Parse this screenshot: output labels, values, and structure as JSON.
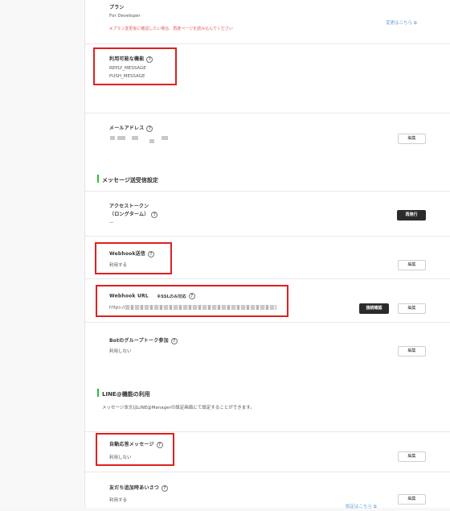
{
  "plan": {
    "label": "プラン",
    "value": "For Developer",
    "warning": "※プラン変更後に確認したい場合、再度ページを読み込んでください",
    "change_link": "変更はこちら"
  },
  "features": {
    "label": "利用可能な機能",
    "items": [
      "REPLY_MESSAGE",
      "PUSH_MESSAGE"
    ]
  },
  "email": {
    "label": "メールアドレス",
    "edit": "編集"
  },
  "messaging_section": {
    "title": "メッセージ送受信設定"
  },
  "access_token": {
    "label_line1": "アクセストークン",
    "label_line2": "（ロングターム）",
    "value": "—",
    "reissue": "再発行"
  },
  "webhook_send": {
    "label": "Webhook送信",
    "value": "利用する",
    "edit": "編集"
  },
  "webhook_url": {
    "label": "Webhook URL",
    "note": "※SSLのみ対応",
    "prefix": "https://",
    "verify": "接続確認",
    "edit": "編集"
  },
  "group_join": {
    "label": "Botのグループトーク参加",
    "value": "利用しない",
    "edit": "編集"
  },
  "line_section": {
    "title": "LINE@機能の利用",
    "desc": "メッセージ本文はLINE@Managerの設定画面にて設定することができます。"
  },
  "auto_reply": {
    "label": "自動応答メッセージ",
    "value": "利用しない",
    "edit": "編集"
  },
  "friend_greeting": {
    "label": "友だち追加時あいさつ",
    "value": "利用する",
    "settings_link": "設定はこちら",
    "edit": "編集"
  },
  "icons": {
    "help": "?",
    "external": "⧉"
  }
}
